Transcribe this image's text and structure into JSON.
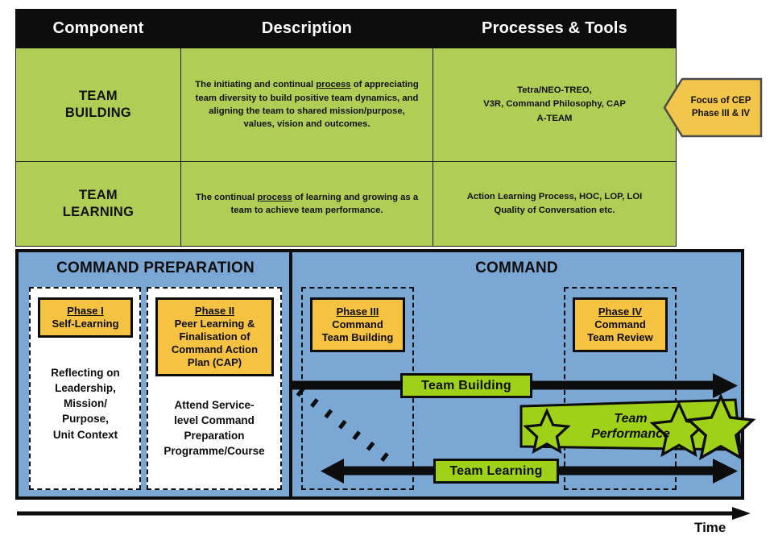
{
  "table": {
    "headers": [
      "Component",
      "Description",
      "Processes & Tools"
    ],
    "rows": [
      {
        "component": "TEAM\nBUILDING",
        "component_line1": "TEAM",
        "component_line2": "BUILDING",
        "description_pre": "The initiating and continual ",
        "description_underlined": "process",
        "description_post": " of appreciating team diversity to build positive team dynamics, and aligning the team to shared mission/purpose, values, vision and outcomes.",
        "tools_line1": "Tetra/NEO-TREO,",
        "tools_line2": "V3R, Command Philosophy, CAP",
        "tools_line3": "A-TEAM"
      },
      {
        "component_line1": "TEAM",
        "component_line2": "LEARNING",
        "description_pre": "The continual ",
        "description_underlined": "process",
        "description_post": " of learning and growing as a team to achieve team performance.",
        "tools_line1": "Action Learning Process, HOC, LOP, LOI",
        "tools_line2": "Quality of Conversation etc.",
        "tools_line3": ""
      }
    ]
  },
  "callout": {
    "line1": "Focus of CEP",
    "line2": "Phase III & IV"
  },
  "diagram": {
    "panels": [
      {
        "title": "COMMAND PREPARATION"
      },
      {
        "title": "COMMAND"
      }
    ],
    "phases": [
      {
        "id": "phase-1",
        "title": "Phase I",
        "body_line1": "Self-Learning",
        "body_line2": "",
        "body_line3": "",
        "detail_line1": "Reflecting on",
        "detail_line2": "Leadership,",
        "detail_line3": "Mission/",
        "detail_line4": "Purpose,",
        "detail_line5": "Unit Context"
      },
      {
        "id": "phase-2",
        "title": "Phase II",
        "body_line1": "Peer Learning &",
        "body_line2": "Finalisation of",
        "body_line3": "Command Action",
        "body_line4": "Plan (CAP)",
        "detail_line1": "Attend Service-",
        "detail_line2": "level Command",
        "detail_line3": "Preparation",
        "detail_line4": "Programme/Course"
      },
      {
        "id": "phase-3",
        "title": "Phase III",
        "body_line1": "Command",
        "body_line2": "Team Building"
      },
      {
        "id": "phase-4",
        "title": "Phase IV",
        "body_line1": "Command",
        "body_line2": "Team Review"
      }
    ],
    "arrows": [
      {
        "id": "team-building-arrow",
        "label": "Team Building"
      },
      {
        "id": "team-learning-arrow",
        "label": "Team Learning"
      }
    ],
    "performance": {
      "line1": "Team",
      "line2": "Performance",
      "star_count": 3
    },
    "time_axis_label": "Time"
  },
  "colors": {
    "header_black": "#0d0d0d",
    "table_green": "#b0ce55",
    "label_green": "#9fd118",
    "phase_yellow": "#f5c242",
    "callout_yellow": "#f2c54b",
    "panel_blue": "#7ba7d4",
    "white": "#ffffff"
  }
}
